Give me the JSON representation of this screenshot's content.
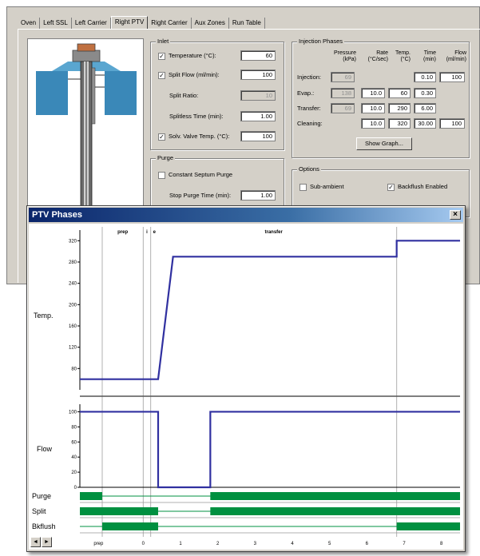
{
  "tabs": [
    "Oven",
    "Left SSL",
    "Left Carrier",
    "Right PTV",
    "Right Carrier",
    "Aux Zones",
    "Run Table"
  ],
  "active_tab": "Right PTV",
  "inlet": {
    "group_label": "Inlet",
    "temperature": {
      "label": "Temperature (°C):",
      "value": "60",
      "checked": true
    },
    "split_flow": {
      "label": "Split Flow (ml/min):",
      "value": "100",
      "checked": true
    },
    "split_ratio": {
      "label": "Split Ratio:",
      "value": "10"
    },
    "splitless_time": {
      "label": "Splitless Time (min):",
      "value": "1.00"
    },
    "solv_valve_temp": {
      "label": "Solv. Valve Temp. (°C):",
      "value": "100",
      "checked": true
    }
  },
  "purge": {
    "group_label": "Purge",
    "constant_septum": {
      "label": "Constant Septum  Purge",
      "checked": false
    },
    "stop_purge_time": {
      "label": "Stop Purge Time (min):",
      "value": "1.00"
    }
  },
  "injection_phases": {
    "group_label": "Injection Phases",
    "headers": {
      "pressure": "Pressure\n(kPa)",
      "rate": "Rate\n(°C/sec)",
      "temp": "Temp.\n(°C)",
      "time": "Time\n(min)",
      "flow": "Flow\n(ml/min)"
    },
    "rows": [
      {
        "label": "Injection:",
        "pressure": "69",
        "rate": "",
        "temp": "",
        "time": "0.10",
        "flow": "100"
      },
      {
        "label": "Evap.:",
        "pressure": "138",
        "rate": "10.0",
        "temp": "60",
        "time": "0.30",
        "flow": ""
      },
      {
        "label": "Transfer:",
        "pressure": "69",
        "rate": "10.0",
        "temp": "290",
        "time": "6.00",
        "flow": ""
      },
      {
        "label": "Cleaning:",
        "pressure": "",
        "rate": "10.0",
        "temp": "320",
        "time": "30.00",
        "flow": "100"
      }
    ],
    "show_graph_button": "Show Graph..."
  },
  "options": {
    "group_label": "Options",
    "sub_ambient": {
      "label": "Sub-ambient",
      "checked": false
    },
    "backflush": {
      "label": "Backflush Enabled",
      "checked": true
    }
  },
  "ptv_window": {
    "title": "PTV Phases",
    "close_glyph": "×",
    "scroll_left": "◄",
    "scroll_right": "►"
  },
  "chart_data": {
    "type": "line",
    "phase_labels": [
      "prep",
      "i",
      "e",
      "transfer"
    ],
    "phase_bottom_label": "prep",
    "x_ticks": [
      0,
      1,
      2,
      3,
      4,
      5,
      6,
      7,
      8
    ],
    "xlim": [
      -1.7,
      8.5
    ],
    "temp_panel": {
      "ylabel": "Temp.",
      "y_ticks": [
        80,
        120,
        160,
        200,
        240,
        280,
        320
      ],
      "ylim": [
        40,
        340
      ],
      "series": {
        "x": [
          -1.7,
          0.4,
          0.8,
          6.8,
          6.8,
          8.5
        ],
        "y": [
          60,
          60,
          290,
          290,
          320,
          320
        ]
      }
    },
    "flow_panel": {
      "ylabel": "Flow",
      "y_ticks": [
        0,
        20,
        40,
        60,
        80,
        100
      ],
      "ylim": [
        0,
        110
      ],
      "series": {
        "x": [
          -1.7,
          0.4,
          0.4,
          1.8,
          1.8,
          8.5
        ],
        "y": [
          100,
          100,
          0,
          0,
          100,
          100
        ]
      }
    },
    "digital_rows": [
      {
        "label": "Purge",
        "on": [
          [
            -1.7,
            -1.1
          ],
          [
            1.8,
            8.5
          ]
        ]
      },
      {
        "label": "Split",
        "on": [
          [
            -1.7,
            0.4
          ],
          [
            1.8,
            8.5
          ]
        ]
      },
      {
        "label": "Bkflush",
        "on": [
          [
            -1.1,
            0.4
          ],
          [
            6.8,
            8.5
          ]
        ]
      }
    ],
    "phase_boundaries": [
      -1.1,
      0.0,
      0.2,
      6.8
    ],
    "colors": {
      "trace": "#3030a0",
      "digital": "#009040",
      "axis": "#000000",
      "grid": "#b0b0b0"
    }
  }
}
